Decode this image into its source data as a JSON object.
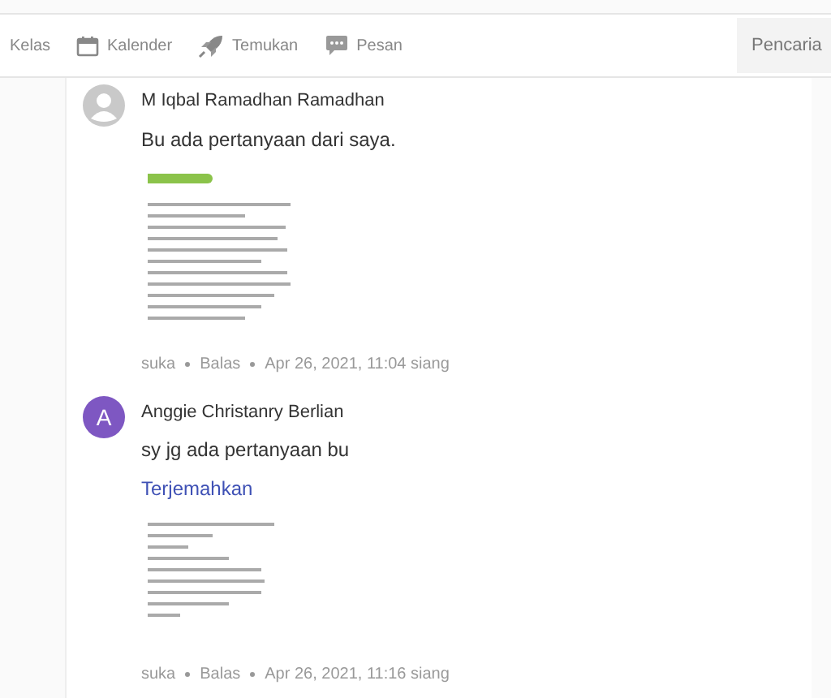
{
  "nav": {
    "items": [
      {
        "label": "Kelas"
      },
      {
        "label": "Kalender"
      },
      {
        "label": "Temukan"
      },
      {
        "label": "Pesan"
      }
    ],
    "search": {
      "placeholder": "Pencaria"
    }
  },
  "comments": [
    {
      "author": "M Iqbal Ramadhan Ramadhan",
      "avatar": {
        "kind": "silhouette"
      },
      "text": "Bu ada pertanyaan dari saya.",
      "attachment": {
        "kind": "worksheet"
      },
      "actions": [
        "suka",
        "Balas"
      ],
      "time": "Apr 26, 2021, 11:04 siang"
    },
    {
      "author": "Anggie Christanry Berlian",
      "avatar": {
        "kind": "letter",
        "letter": "A",
        "color": "#7e57c2"
      },
      "text": "sy jg ada pertanyaan bu",
      "translate": "Terjemahkan",
      "attachment": {
        "kind": "formulas"
      },
      "actions": [
        "suka",
        "Balas"
      ],
      "time": "Apr 26, 2021, 11:16 siang"
    }
  ]
}
